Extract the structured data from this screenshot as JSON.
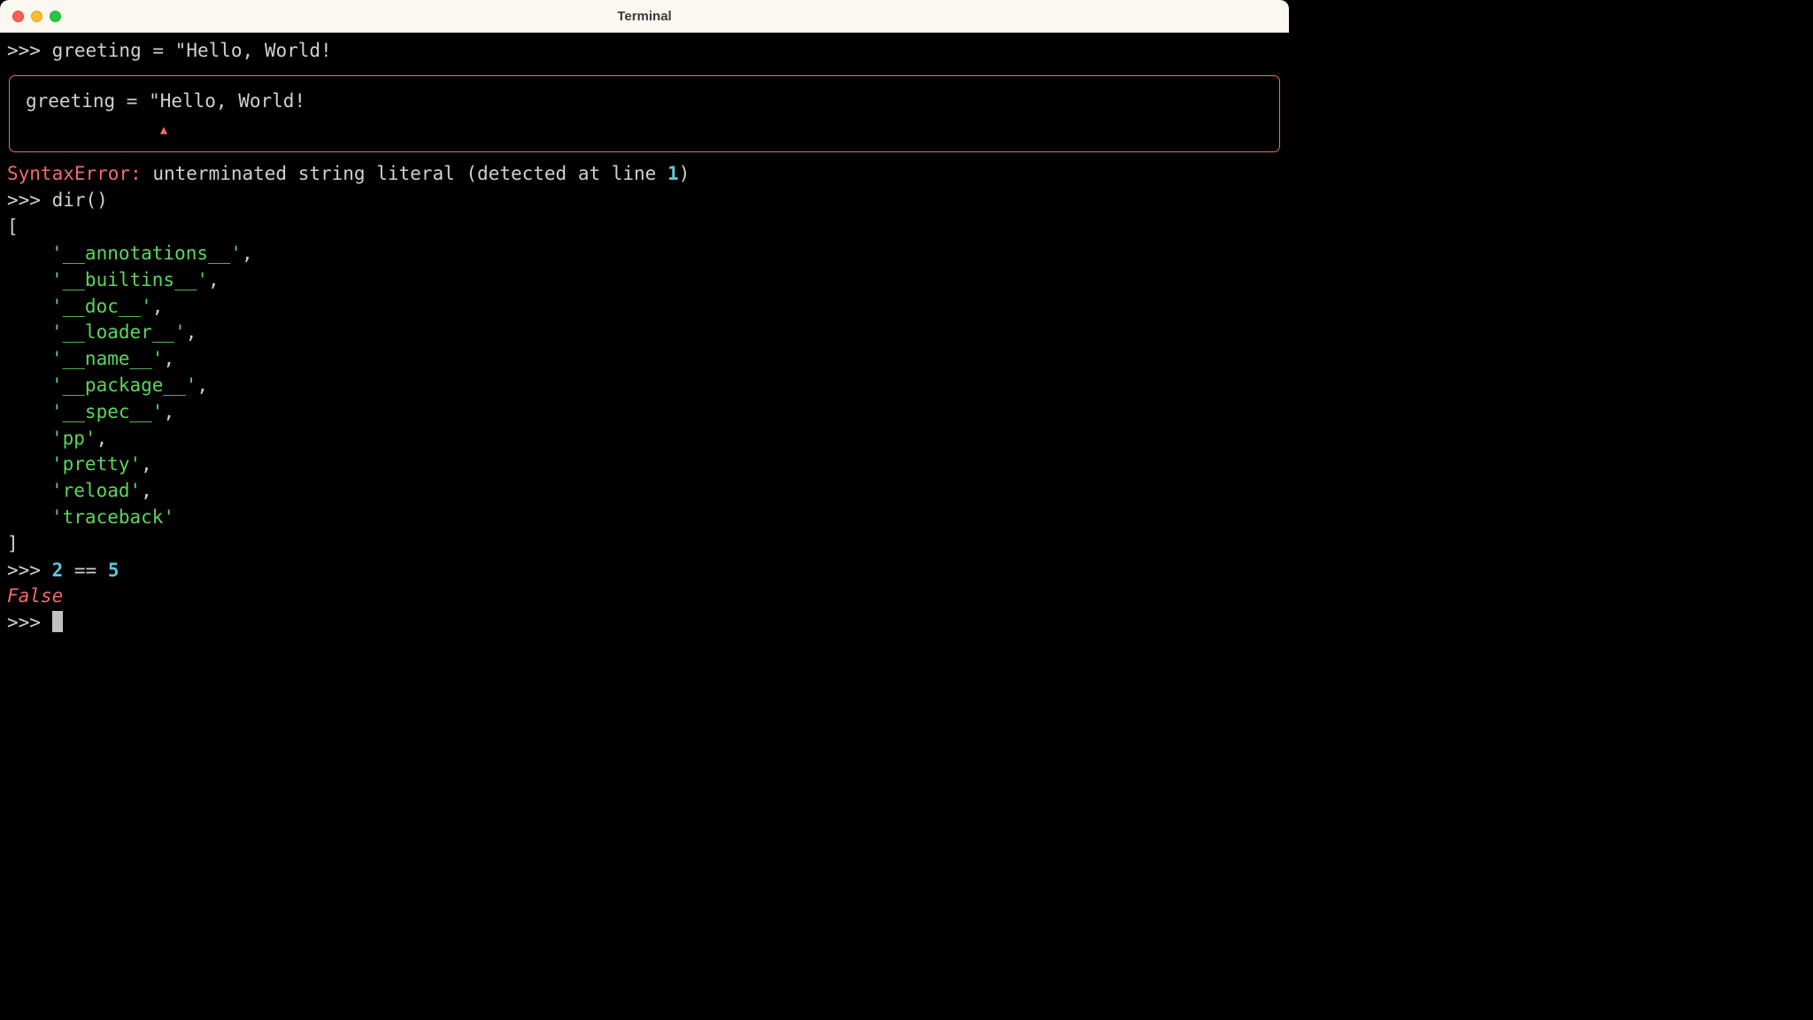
{
  "window": {
    "title": "Terminal"
  },
  "session": {
    "prompt": ">>> ",
    "line1": {
      "var": "greeting",
      "eq": " = ",
      "str": "\"Hello, World!"
    },
    "errbox": {
      "code": "greeting = \"Hello, World!",
      "caret_indent": "            ",
      "caret": "▲"
    },
    "error": {
      "name": "SyntaxError:",
      "msg1": " unterminated string literal ",
      "paren_open": "(",
      "detected": "detected at line ",
      "linenum": "1",
      "paren_close": ")"
    },
    "line2": {
      "func": "dir",
      "parens": "()"
    },
    "dir_open": "[",
    "dir_items": [
      "'__annotations__'",
      "'__builtins__'",
      "'__doc__'",
      "'__loader__'",
      "'__name__'",
      "'__package__'",
      "'__spec__'",
      "'pp'",
      "'pretty'",
      "'reload'",
      "'traceback'"
    ],
    "dir_close": "]",
    "line3": {
      "lhs": "2",
      "op": " == ",
      "rhs": "5"
    },
    "result3": "False"
  },
  "comma": ","
}
